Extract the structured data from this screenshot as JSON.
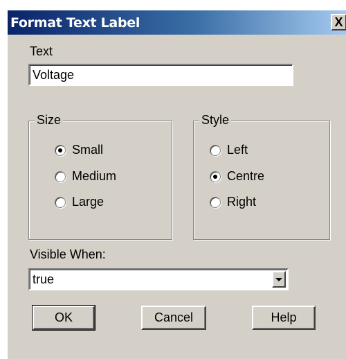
{
  "window": {
    "title": "Format Text Label",
    "close_glyph": "X"
  },
  "text_field": {
    "label": "Text",
    "value": "Voltage"
  },
  "size_group": {
    "legend": "Size",
    "options": [
      {
        "label": "Small",
        "checked": true
      },
      {
        "label": "Medium",
        "checked": false
      },
      {
        "label": "Large",
        "checked": false
      }
    ]
  },
  "style_group": {
    "legend": "Style",
    "options": [
      {
        "label": "Left",
        "checked": false
      },
      {
        "label": "Centre",
        "checked": true
      },
      {
        "label": "Right",
        "checked": false
      }
    ]
  },
  "visible_when": {
    "label": "Visible When:",
    "value": "true"
  },
  "buttons": {
    "ok": "OK",
    "cancel": "Cancel",
    "help": "Help"
  }
}
